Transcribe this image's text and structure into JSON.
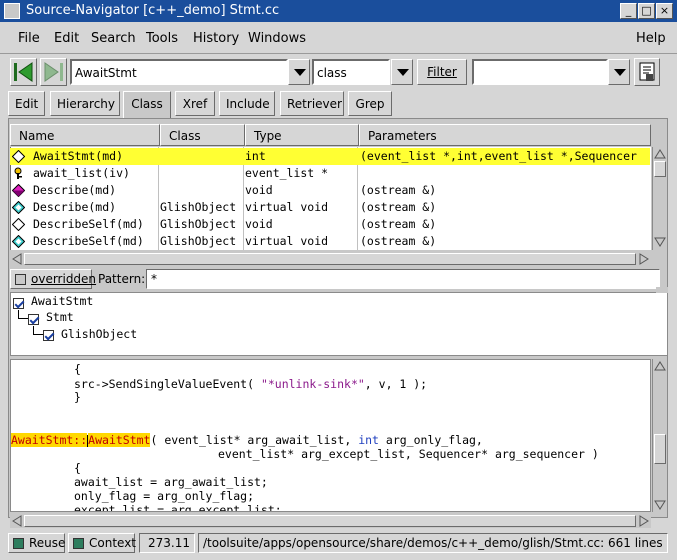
{
  "window": {
    "title": "Source-Navigator [c++_demo] Stmt.cc"
  },
  "menubar": {
    "items": [
      "File",
      "Edit",
      "Search",
      "Tools",
      "History",
      "Windows"
    ],
    "help": "Help"
  },
  "toolbar": {
    "symbol_value": "AwaitStmt",
    "type_value": "class",
    "filter_label": "Filter",
    "filter_value": ""
  },
  "tabs": [
    "Edit",
    "Hierarchy",
    "Class",
    "Xref",
    "Include",
    "Retriever",
    "Grep"
  ],
  "active_tab": "Class",
  "class_browser": {
    "columns": [
      "Name",
      "Class",
      "Type",
      "Parameters"
    ],
    "rows": [
      {
        "icon": "diamond-outline-icon",
        "name": "AwaitStmt(md)",
        "class": "",
        "type": "int",
        "params": "(event_list *,int,event_list *,Sequencer",
        "selected": true
      },
      {
        "icon": "lock-key-icon",
        "name": "await_list(iv)",
        "class": "",
        "type": "event_list *",
        "params": "",
        "selected": false
      },
      {
        "icon": "diamond-magenta-icon",
        "name": "Describe(md)",
        "class": "",
        "type": "void",
        "params": "(ostream &)",
        "selected": false
      },
      {
        "icon": "diamond-cyan-icon",
        "name": "Describe(md)",
        "class": "GlishObject",
        "type": "virtual void",
        "params": "(ostream &)",
        "selected": false
      },
      {
        "icon": "diamond-outline-icon",
        "name": "DescribeSelf(md)",
        "class": "GlishObject",
        "type": "void",
        "params": "(ostream &)",
        "selected": false
      },
      {
        "icon": "diamond-cyan-icon",
        "name": "DescribeSelf(md)",
        "class": "GlishObject",
        "type": "virtual void",
        "params": "(ostream &)",
        "selected": false
      }
    ]
  },
  "filter_bar": {
    "overridden_label": "overridden",
    "pattern_label": "Pattern:",
    "pattern_value": "*"
  },
  "hierarchy": [
    "AwaitStmt",
    "Stmt",
    "GlishObject"
  ],
  "code": {
    "line1": "{",
    "line2_a": "src->SendSingleValueEvent( ",
    "line2_str": "\"*unlink-sink*\"",
    "line2_b": ", v, 1 );",
    "line3": "}",
    "line4_hl1": "AwaitStmt::",
    "line4_hl2": "AwaitStmt",
    "line4_a": "( event_list* arg_await_list, ",
    "line4_kw": "int",
    "line4_b": " arg_only_flag,",
    "line5": "event_list* arg_except_list, Sequencer* arg_sequencer )",
    "line6": "{",
    "line7": "await_list = arg_await_list;",
    "line8": "only_flag = arg_only_flag;",
    "line9": "except_list = arg_except_list;"
  },
  "statusbar": {
    "reuse_label": "Reuse",
    "context_label": "Context",
    "position": "273.11",
    "path": "/toolsuite/apps/opensource/share/demos/c++_demo/glish/Stmt.cc: 661 lines"
  }
}
